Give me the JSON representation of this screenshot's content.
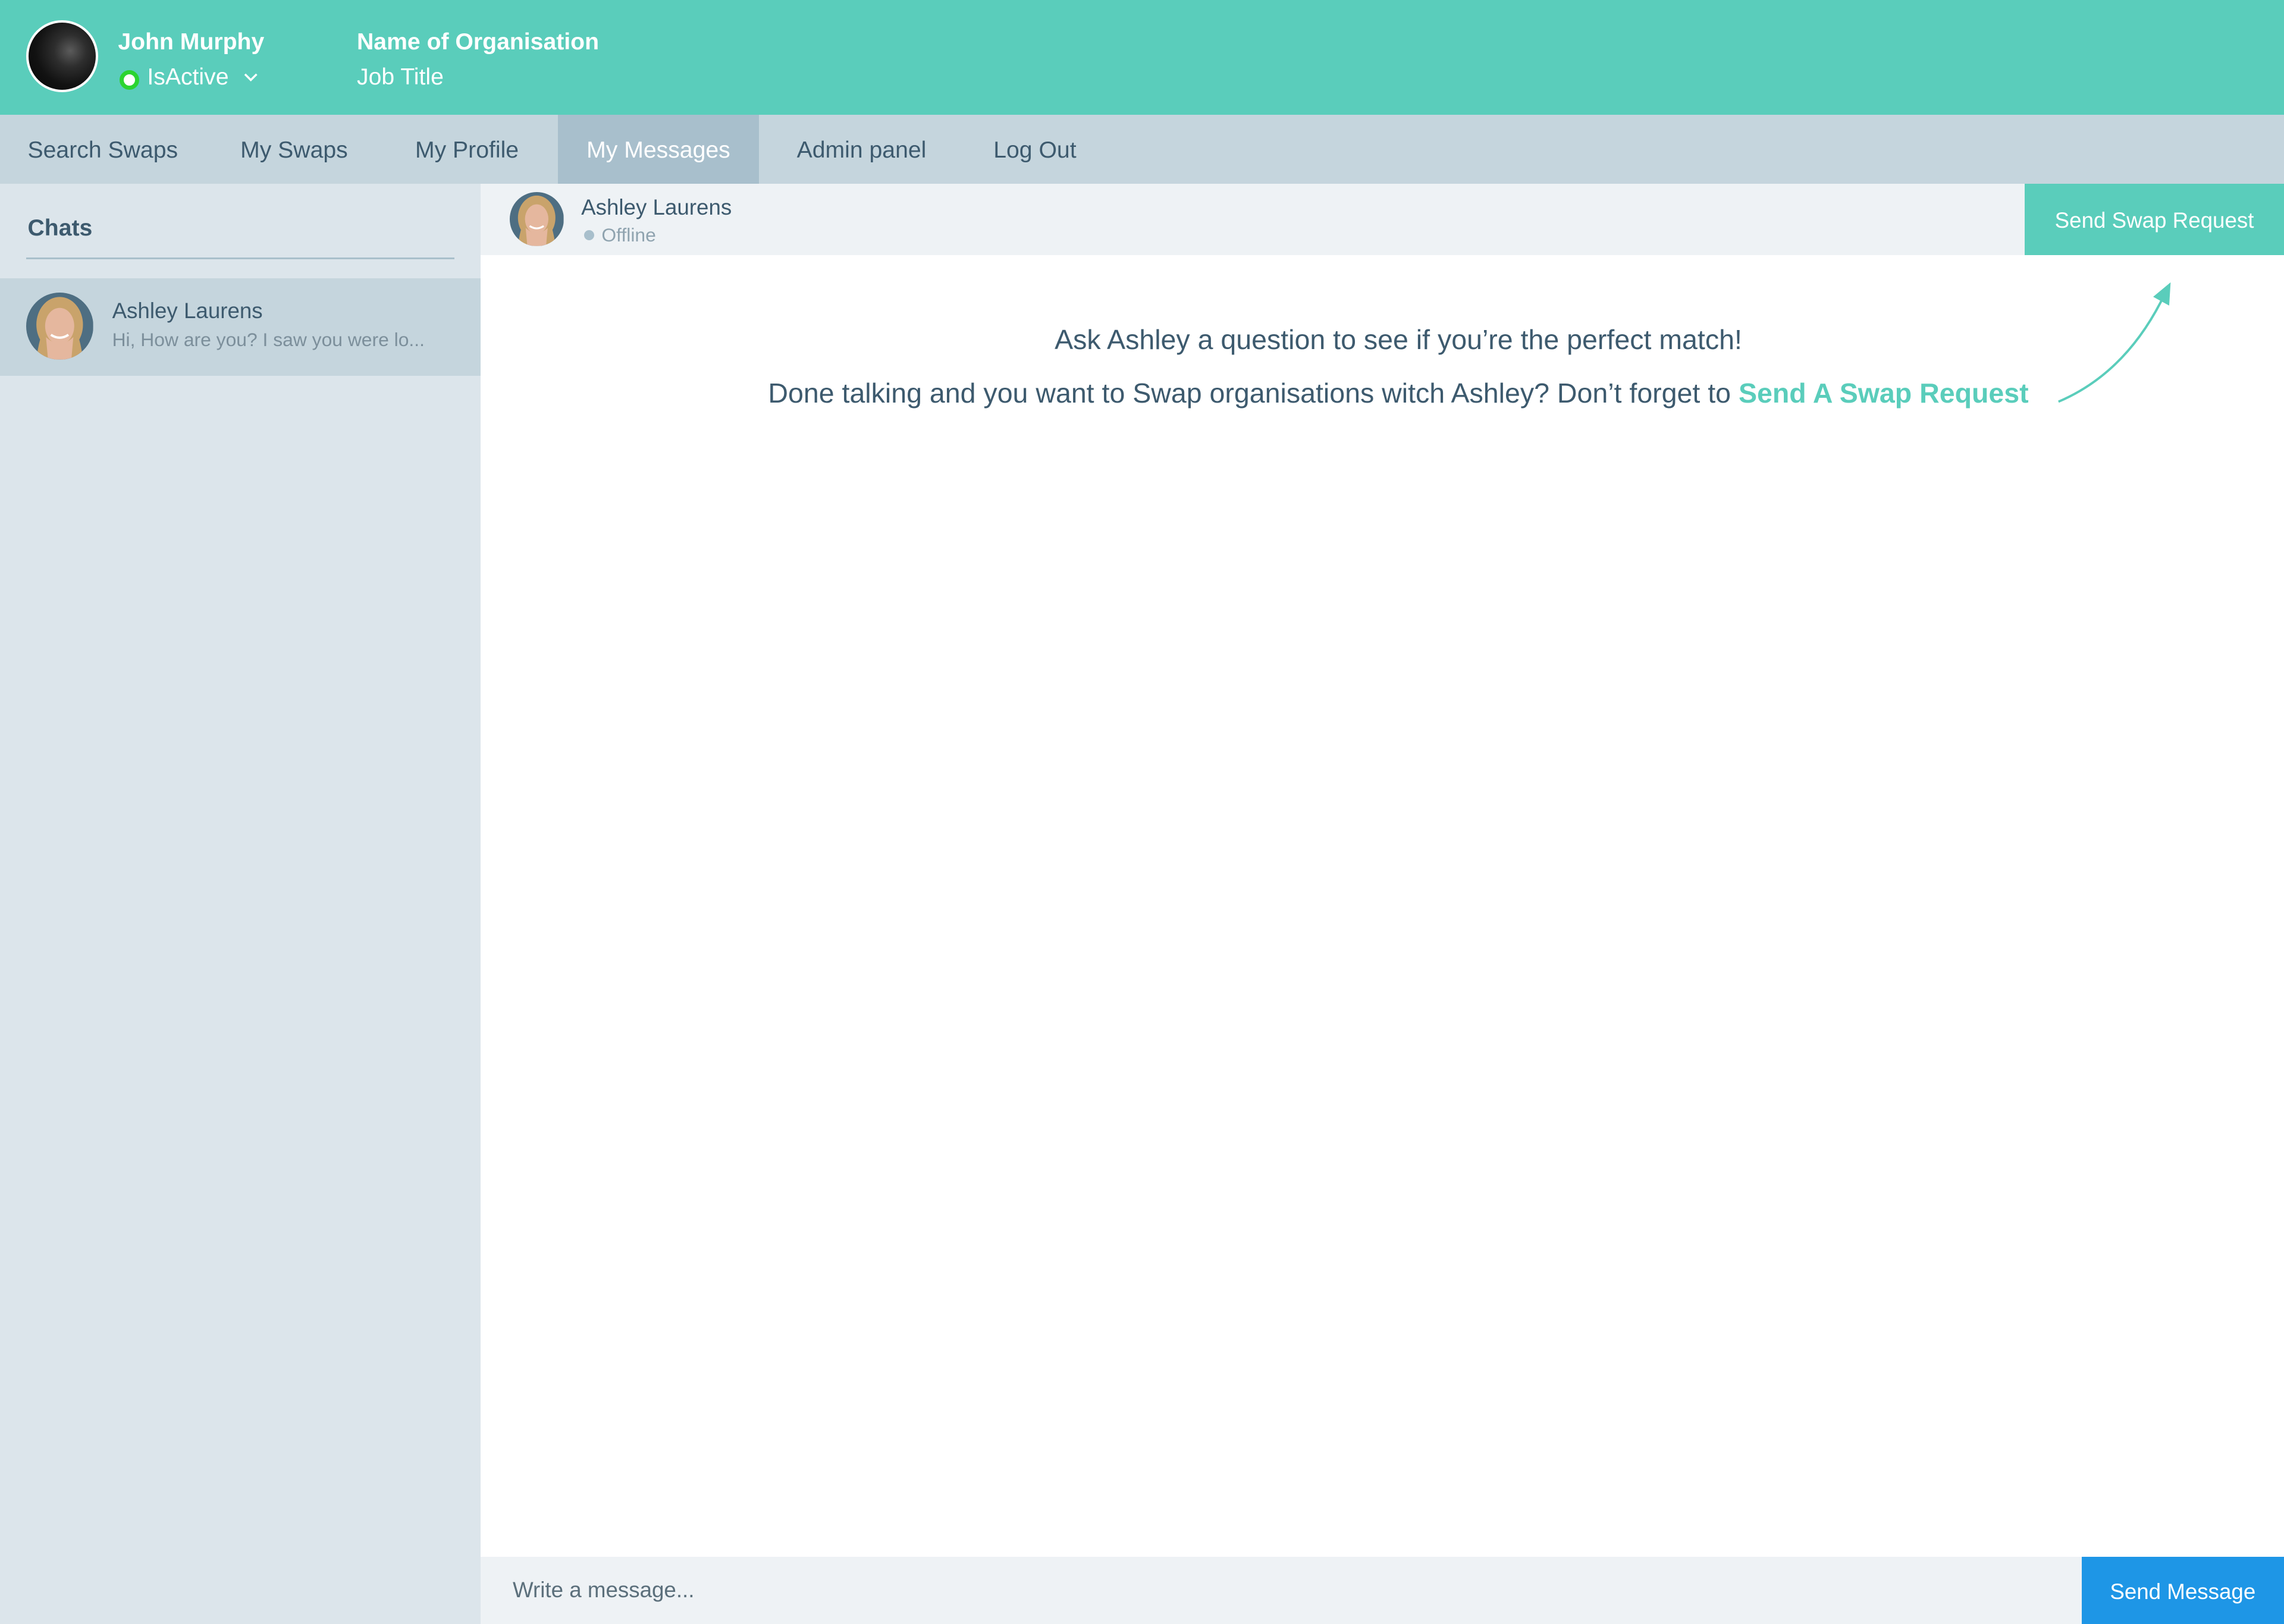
{
  "user": {
    "name": "John Murphy",
    "status": "IsActive",
    "organisation": "Name of Organisation",
    "job_title": "Job Title"
  },
  "nav": {
    "items": [
      {
        "label": "Search Swaps",
        "active": false
      },
      {
        "label": "My Swaps",
        "active": false
      },
      {
        "label": "My Profile",
        "active": false
      },
      {
        "label": "My Messages",
        "active": true
      },
      {
        "label": "Admin panel",
        "active": false
      },
      {
        "label": "Log Out",
        "active": false
      }
    ]
  },
  "sidebar": {
    "title": "Chats",
    "chats": [
      {
        "name": "Ashley Laurens",
        "preview": "Hi, How are you? I saw you were lo..."
      }
    ]
  },
  "conversation": {
    "name": "Ashley Laurens",
    "status": "Offline",
    "swap_button": "Send Swap Request",
    "hint_line1": "Ask Ashley a question to see if you’re the perfect match!",
    "hint_line2": "Done talking and you want to Swap organisations witch Ashley? Don’t forget to",
    "hint_link": "Send A Swap Request"
  },
  "composer": {
    "placeholder": "Write a message...",
    "send_label": "Send Message"
  },
  "colors": {
    "brand": "#5acdbb",
    "nav_bg": "#c5d5dd",
    "nav_active": "#a8bfcc",
    "sidebar_bg": "#dce5eb",
    "text": "#3d5a6e",
    "send_button": "#1e96e6",
    "online": "#2bd430"
  }
}
